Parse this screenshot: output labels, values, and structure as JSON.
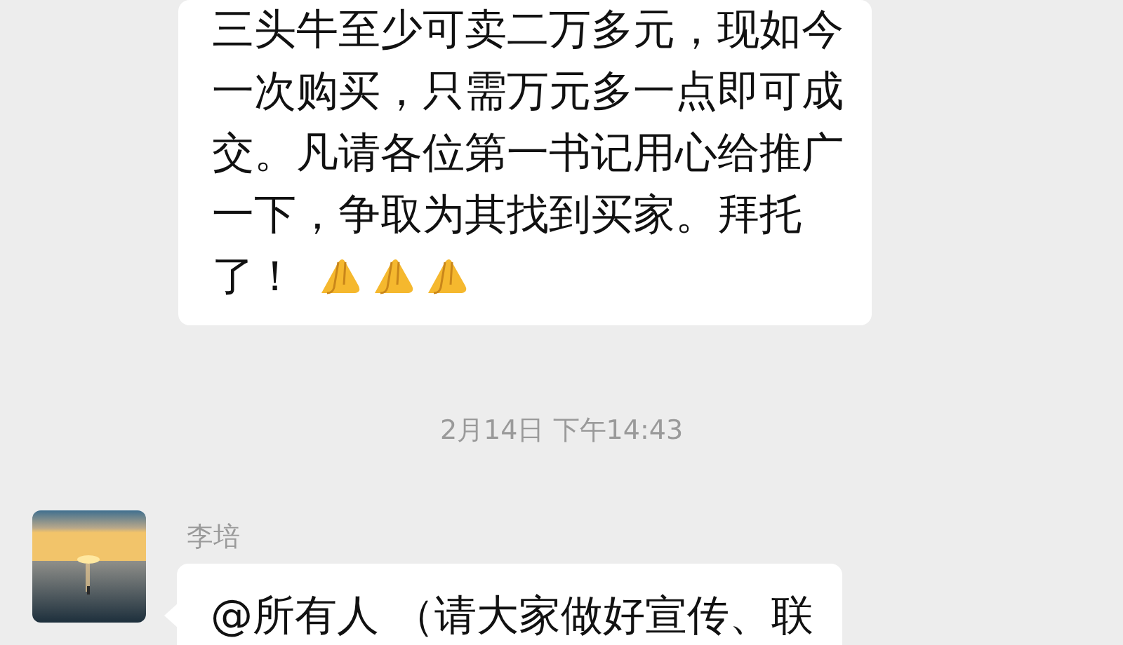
{
  "messages": [
    {
      "kind": "continued",
      "lines": [
        "三头牛至少可卖二万多元，现如今",
        "一次购买，只需万元多一点即可成",
        "交。凡请各位第一书记用心给推广",
        "一下，争取为其找到买家。拜托",
        "了！"
      ],
      "emojis": [
        {
          "kind": "pray"
        },
        {
          "kind": "pray"
        },
        {
          "kind": "pray"
        }
      ]
    },
    {
      "kind": "timestamp",
      "text": "2月14日 下午14:43"
    },
    {
      "kind": "message",
      "sender": "李培",
      "lines": [
        "@所有人 （请大家做好宣传、联"
      ]
    }
  ]
}
